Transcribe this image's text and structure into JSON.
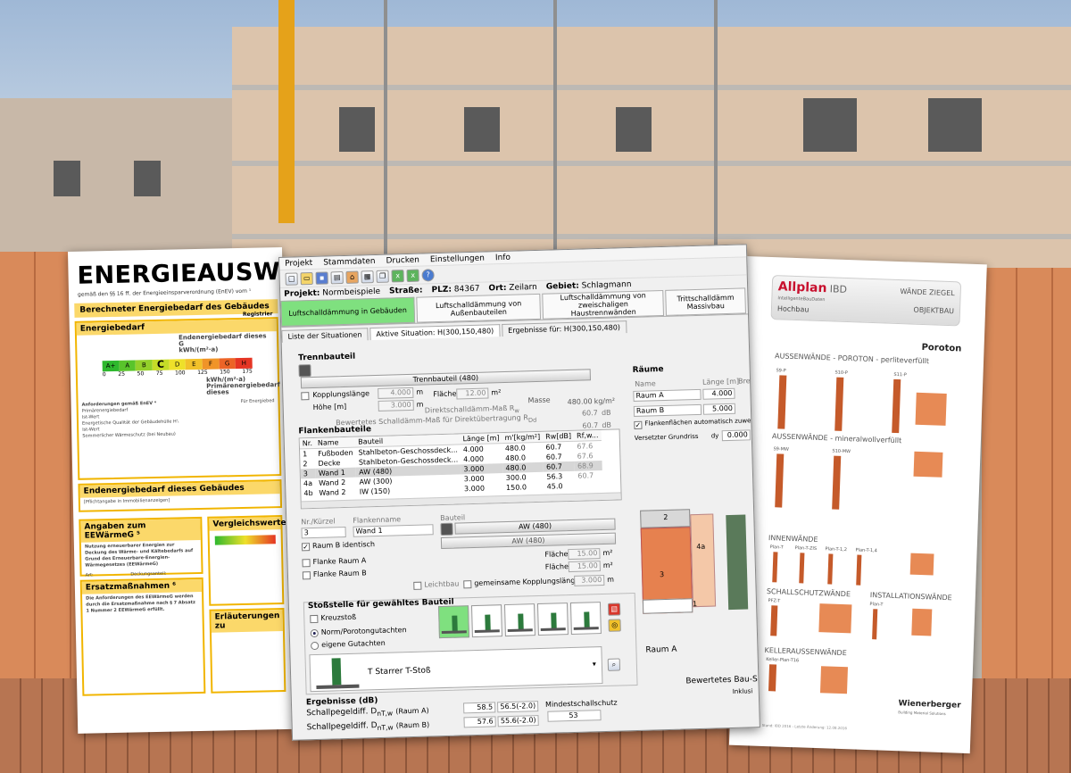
{
  "energy_certificate": {
    "title": "ENERGIEAUSWEIS",
    "subtitle": "gemäß den §§ 16 ff. der Energieeinsparverordnung (EnEV) vom ¹",
    "section_calc": "Berechneter Energiebedarf des Gebäudes",
    "section_calc_side": "Registrier",
    "energy_demand_head": "Energiebedarf",
    "end_energy_label": "Endenergiebedarf dieses G",
    "end_energy_unit": "kWh/(m²·a)",
    "scale_classes": [
      "A+",
      "A",
      "B",
      "C",
      "D",
      "E",
      "F",
      "G",
      "H"
    ],
    "scale_ticks": [
      "0",
      "25",
      "50",
      "75",
      "100",
      "125",
      "150",
      "175"
    ],
    "primary_unit": "kWh/(m²·a)",
    "primary_label": "Primärenergiebedarf dieses",
    "requirements_label": "Anforderungen gemäß EnEV ⁴",
    "requirements_right": "Für Energiebed",
    "requirements_lines": [
      "Primärenergiebedarf",
      "Ist-Wert",
      "Energetische Qualität der Gebäudehülle H'ₜ",
      "Ist-Wert",
      "Sommerlicher Wärmeschutz (bei Neubau)"
    ],
    "final_demand_head": "Endenergiebedarf dieses Gebäudes",
    "final_demand_sub": "[Pflichtangabe in Immobilienanzeigen]",
    "eewaerme_head": "Angaben zum EEWärmeG ⁵",
    "eewaerme_text": "Nutzung erneuerbarer Energien zur Deckung des Wärme- und Kältebedarfs auf Grund des Erneuerbare-Energien-Wärmegesetzes (EEWärmeG)",
    "eewaerme_col1": "Art:",
    "eewaerme_col2": "Deckungsanteil:",
    "compare_head": "Vergleichswerte",
    "ersatz_head": "Ersatzmaßnahmen ⁶",
    "ersatz_text": "Die Anforderungen des EEWärmeG werden durch die Ersatzmaßnahme nach § 7 Absatz 1 Nummer 2 EEWärmeG erfüllt.",
    "erlaeut_head": "Erläuterungen zu"
  },
  "app": {
    "menu": [
      "Projekt",
      "Stammdaten",
      "Drucken",
      "Einstellungen",
      "Info"
    ],
    "project": {
      "project_label": "Projekt:",
      "project_value": "Normbeispiele",
      "street_label": "Straße:",
      "plz_label": "PLZ:",
      "plz_value": "84367",
      "city_label": "Ort:",
      "city_value": "Zeilarn",
      "region_label": "Gebiet:",
      "region_value": "Schlagmann"
    },
    "mode_tabs": [
      "Luftschalldämmung in Gebäuden",
      "Luftschalldämmung von Außenbauteilen",
      "Luftschalldämmung von zweischaligen Haustrennwänden",
      "Trittschalldämm Massivbau"
    ],
    "sub_tabs": {
      "list": "Liste der Situationen",
      "active": "Aktive Situation: H(300,150,480)",
      "results": "Ergebnisse für: H(300,150,480)"
    },
    "trennbauteil": {
      "title": "Trennbauteil",
      "element_label": "Trennbauteil (480)",
      "coupling_label": "Kopplungslänge",
      "coupling_value": "4.000",
      "coupling_unit": "m",
      "height_label": "Höhe [m]",
      "height_value": "3.000",
      "height_unit": "m",
      "area_label": "Fläche",
      "area_value": "12.00",
      "area_unit": "m²",
      "mass_label": "Masse",
      "mass_value": "480.00",
      "mass_unit": "kg/m²",
      "direct_label": "Direktschalldämm-Maß R",
      "direct_sub": "w",
      "direct_value": "60.7",
      "direct_unit": "dB",
      "rated_label": "Bewertetes Schalldämm-Maß für Direktübertragung R",
      "rated_sub": "Dd",
      "rated_value": "60.7",
      "rated_unit": "dB"
    },
    "raeume": {
      "title": "Räume",
      "col_name": "Name",
      "col_length": "Länge [m]",
      "col_width": "Breit",
      "room_a": "Raum A",
      "room_a_length": "4.000",
      "room_b": "Raum B",
      "room_b_length": "5.000",
      "auto_flank": "Flankenflächen automatisch zuweisen",
      "offset_label": "Versetzter Grundriss",
      "dy_label": "dy",
      "dy_value": "0.000"
    },
    "flanken": {
      "title": "Flankenbauteile",
      "headers": [
        "Nr.",
        "Name",
        "Bauteil",
        "Länge [m]",
        "m'[kg/m²]",
        "Rw[dB]",
        "Rf,w..."
      ],
      "rows": [
        [
          "1",
          "Fußboden",
          "Stahlbeton-Geschossdeck...",
          "4.000",
          "480.0",
          "60.7",
          "67.6"
        ],
        [
          "2",
          "Decke",
          "Stahlbeton-Geschossdeck...",
          "4.000",
          "480.0",
          "60.7",
          "67.6"
        ],
        [
          "3",
          "Wand 1",
          "AW (480)",
          "3.000",
          "480.0",
          "60.7",
          "68.9"
        ],
        [
          "4a",
          "Wand 2",
          "AW (300)",
          "3.000",
          "300.0",
          "56.3",
          "60.7"
        ],
        [
          "4b",
          "Wand 2",
          "IW (150)",
          "3.000",
          "150.0",
          "45.0",
          ""
        ]
      ]
    },
    "detail": {
      "nr_label": "Nr./Kürzel",
      "nr_value": "3",
      "flankname_label": "Flankenname",
      "flankname_value": "Wand 1",
      "bauteil_label": "Bauteil",
      "bauteil_a": "AW (480)",
      "bauteil_b": "AW (480)",
      "room_b_identical": "Raum B identisch",
      "flank_a": "Flanke Raum A",
      "flank_b": "Flanke Raum B",
      "area_label": "Fläche",
      "area_a": "15.00",
      "area_b": "15.00",
      "area_unit": "m²",
      "leichtbau": "Leichtbau",
      "shared_coupling": "gemeinsame Kopplungslänge",
      "shared_value": "3.000",
      "shared_unit": "m"
    },
    "stoss": {
      "title": "Stoßstelle für gewähltes Bauteil",
      "kreuzstoss": "Kreuzstoß",
      "norm": "Norm/Porotongutachten",
      "own": "eigene Gutachten",
      "selected_joint": "T Starrer T-Stoß"
    },
    "results": {
      "title": "Ergebnisse (dB)",
      "row1_label": "Schallpegeldiff. D",
      "row1_sub": "nT,w",
      "row1_room": "(Raum A)",
      "row1_value": "58.5",
      "row1_req": "56.5(-2.0)",
      "row2_label": "Schallpegeldiff. D",
      "row2_sub": "nT,w",
      "row2_room": "(Raum B)",
      "row2_value": "57.6",
      "row2_req": "55.6(-2.0)",
      "min_label": "Mindestschallschutz",
      "min_value": "53"
    },
    "diagram": {
      "label_2": "2",
      "label_3": "3",
      "label_4a": "4a",
      "label_1": "1",
      "room_label": "Raum A",
      "footer_left": "Bewertetes Bau-S",
      "footer_right": "Inklusi"
    }
  },
  "catalog": {
    "brand": "Allplan",
    "brand_sub": "IntelligenteBauDaten",
    "ibd": "IBD",
    "section": "Hochbau",
    "right1": "WÄNDE ZIEGEL",
    "right2": "OBJEKTBAU",
    "maker": "Poroton",
    "aussen_poroton": "AUSSENWÄNDE - POROTON - perliteverfüllt",
    "aussen_poroton_items": [
      "S9-P",
      "S10-P",
      "S11-P"
    ],
    "aussen_mw": "AUSSENWÄNDE - mineralwollverfüllt",
    "aussen_mw_items": [
      "S9-MW",
      "S10-MW"
    ],
    "innen": "INNENWÄNDE",
    "innen_items": [
      "Plan-T",
      "Plan-T-ZIS",
      "Plan-T-1,2",
      "Plan-T-1,4"
    ],
    "schall": "SCHALLSCHUTZWÄNDE",
    "schall_items": [
      "PFZ-T"
    ],
    "install": "INSTALLATIONSWÄNDE",
    "install_items": [
      "Plan-T"
    ],
    "keller": "KELLERAUSSENWÄNDE",
    "keller_items": [
      "Keller-Plan-T16"
    ],
    "footer_brand": "Wienerberger",
    "footer_brand_sub": "Building Material Solutions",
    "footer_text": "Stand: IBD 2016 - Letzte Änderung: 12.08.2016"
  },
  "colors": {
    "accent_green": "#7fe07f",
    "certificate_yellow": "#fbd86a",
    "certificate_border": "#f1b500",
    "brick": "#c55a2a",
    "allplan_red": "#c8102e"
  }
}
